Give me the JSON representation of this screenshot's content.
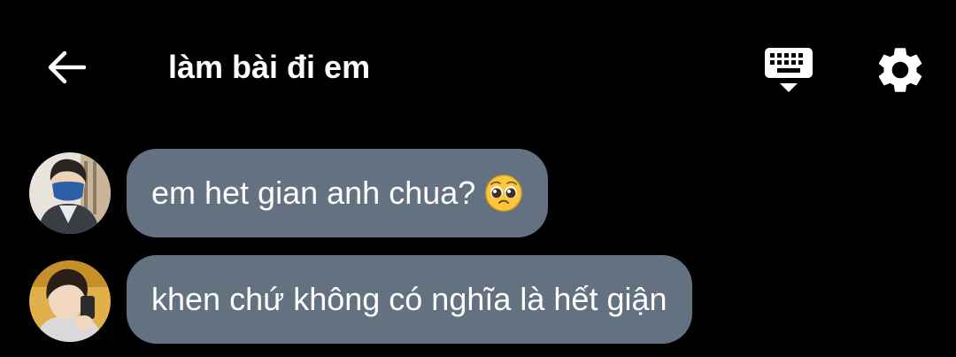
{
  "header": {
    "title": "làm bài đi em",
    "back_icon": "arrow-left-icon",
    "keyboard_icon": "keyboard-hide-icon",
    "settings_icon": "gear-icon"
  },
  "messages": [
    {
      "text": "em het gian anh chua?",
      "emoji": "pleading-face-emoji"
    },
    {
      "text": "khen chứ không có nghĩa là hết giận"
    }
  ],
  "colors": {
    "background": "#000000",
    "bubble": "#637180",
    "text": "#ffffff"
  }
}
